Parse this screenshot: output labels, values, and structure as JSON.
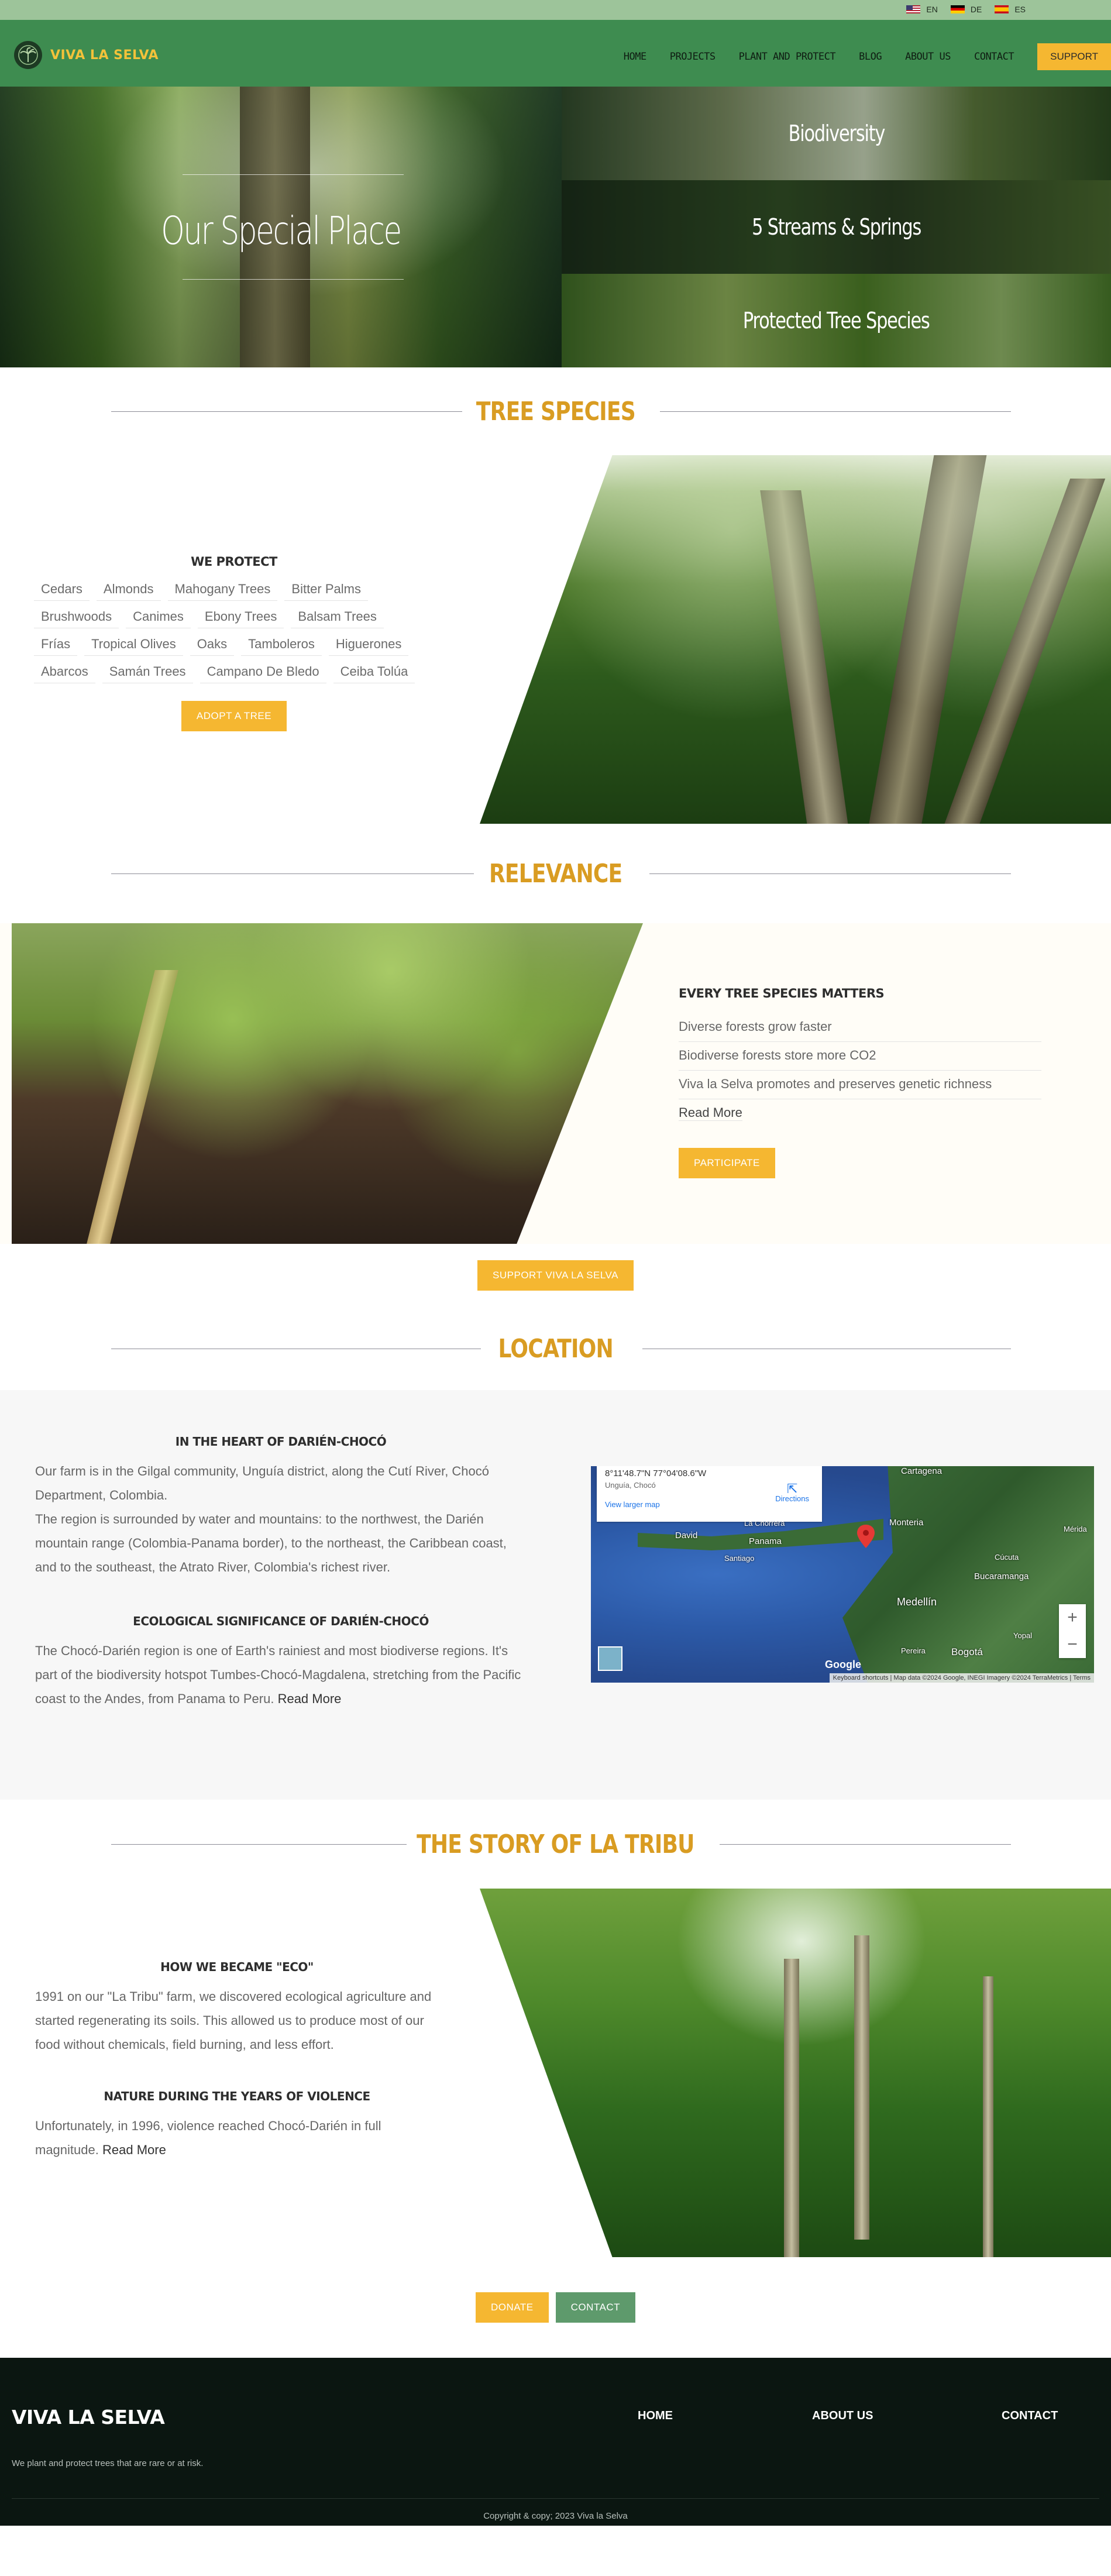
{
  "languages": [
    {
      "code": "EN",
      "flag": "flag-en-icon"
    },
    {
      "code": "DE",
      "flag": "flag-de-icon"
    },
    {
      "code": "ES",
      "flag": "flag-es-icon"
    }
  ],
  "nav": {
    "brand": "VIVA LA SELVA",
    "items": [
      "HOME",
      "PROJECTS",
      "PLANT AND PROTECT",
      "BLOG",
      "ABOUT US",
      "CONTACT"
    ],
    "support": "SUPPORT"
  },
  "hero": {
    "title": "Our Special Place",
    "tiles": [
      "Biodiversity",
      "5 Streams & Springs",
      "Protected Tree Species"
    ]
  },
  "tree_species": {
    "heading": "TREE SPECIES",
    "subtitle": "WE PROTECT",
    "tags": [
      "Cedars",
      "Almonds",
      "Mahogany Trees",
      "Bitter Palms",
      "Brushwoods",
      "Canimes",
      "Ebony Trees",
      "Balsam Trees",
      "Frías",
      "Tropical Olives",
      "Oaks",
      "Tamboleros",
      "Higuerones",
      "Abarcos",
      "Samán Trees",
      "Campano De Bledo",
      "Ceiba Tolúa"
    ],
    "button": "ADOPT A TREE"
  },
  "relevance": {
    "heading": "RELEVANCE",
    "subtitle": "EVERY TREE SPECIES MATTERS",
    "bullets": [
      "Diverse forests grow faster",
      "Biodiverse forests store more CO2",
      "Viva la Selva promotes and preserves genetic richness"
    ],
    "read_more": "Read More",
    "button": "PARTICIPATE",
    "support_button": "SUPPORT VIVA LA SELVA"
  },
  "location": {
    "heading": "LOCATION",
    "block1_title": "IN THE HEART OF DARIÉN-CHOCÓ",
    "block1_p1": "Our farm is in the Gilgal community, Unguía district, along the Cutí River, Chocó Department, Colombia.",
    "block1_p2": "The region is surrounded by water and mountains: to the northwest, the Darién mountain range (Colombia-Panama border), to the northeast, the Caribbean coast, and to the southeast, the Atrato River, Colombia's richest river.",
    "block2_title": "ECOLOGICAL SIGNIFICANCE OF DARIÉN-CHOCÓ",
    "block2_p": "The Chocó-Darién region is one of Earth's rainiest and most biodiverse regions. It's part of the biodiversity hotspot Tumbes-Chocó-Magdalena, stretching from the Pacific coast to the Andes, from Panama to Peru.",
    "read_more": "Read More",
    "map": {
      "coords": "8°11'48.7\"N 77°04'08.6\"W",
      "place": "Unguía, Chocó",
      "larger_map": "View larger map",
      "directions": "Directions",
      "cities": [
        "Cartagena",
        "Panama",
        "Santiago",
        "David",
        "La Chorrera",
        "Monteria",
        "Medellín",
        "Bucaramanga",
        "Bogotá",
        "Pereira",
        "Cúcuta",
        "Mérida",
        "Yopal"
      ],
      "google": "Google",
      "footer": "Keyboard shortcuts | Map data ©2024 Google, INEGI Imagery ©2024 TerraMetrics | Terms"
    }
  },
  "story": {
    "heading": "THE STORY OF LA TRIBU",
    "block1_title": "HOW WE BECAME \"ECO\"",
    "block1_p": "1991 on our \"La Tribu\" farm, we discovered ecological agriculture and started regenerating its soils. This allowed us to produce most of our food without chemicals, field burning, and less effort.",
    "block2_title": "NATURE DURING THE YEARS OF VIOLENCE",
    "block2_p": "Unfortunately, in 1996, violence reached Chocó-Darién in full magnitude.",
    "read_more": "Read More",
    "donate": "DONATE",
    "contact": "CONTACT"
  },
  "footer": {
    "brand": "VIVA LA SELVA",
    "tagline": "We plant and protect trees that are rare or at risk.",
    "links": [
      "HOME",
      "ABOUT US",
      "CONTACT"
    ],
    "copyright": "Copyright & copy; 2023 Viva la Selva"
  },
  "colors": {
    "nav_green": "#3e8c50",
    "top_bar": "#9dc49a",
    "gold": "#f5b731",
    "heading_gold": "#d99c22",
    "footer_bg": "#0b1611"
  }
}
